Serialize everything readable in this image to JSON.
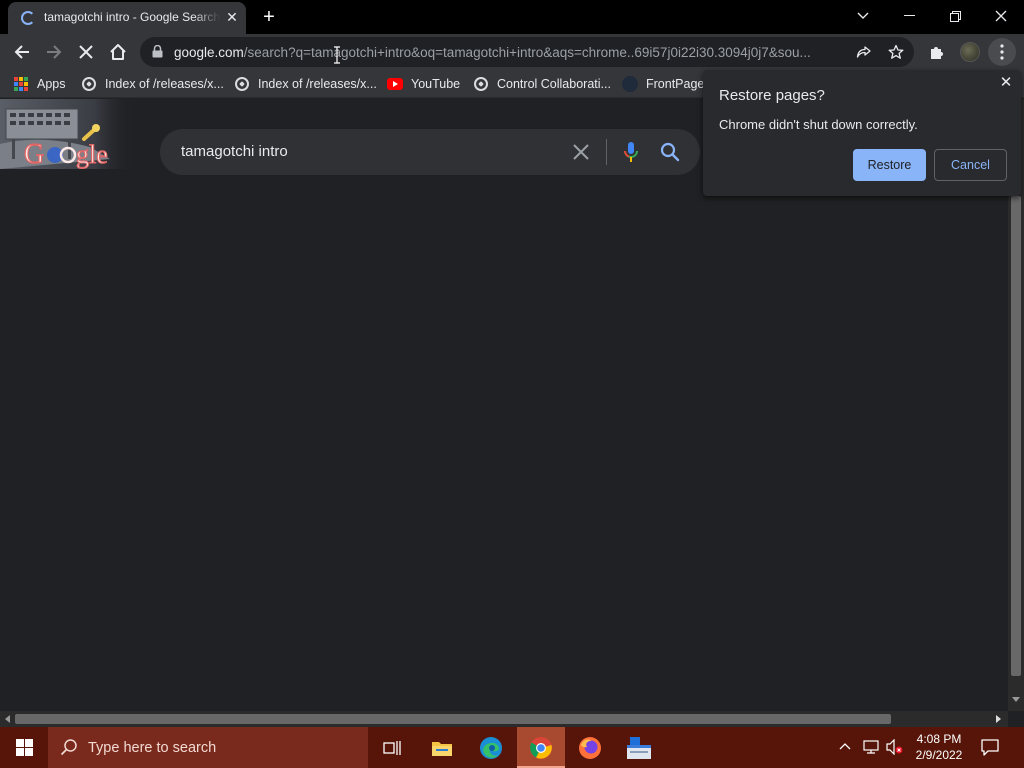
{
  "tab": {
    "title": "tamagotchi intro - Google Search",
    "close_glyph": "✕",
    "new_tab_glyph": "+"
  },
  "window_controls": [
    "chevron-down-icon",
    "minimize-icon",
    "restore-icon",
    "close-icon"
  ],
  "toolbar": {
    "url_host": "google.com",
    "url_path": "/search?q=tamagotchi+intro&oq=tamagotchi+intro&aqs=chrome..69i57j0i22i30.3094j0j7&sou..."
  },
  "bookmarks": [
    {
      "label": "Apps",
      "icon": "apps-grid-icon"
    },
    {
      "label": "Index of /releases/x...",
      "icon": "globe-icon"
    },
    {
      "label": "Index of /releases/x...",
      "icon": "globe-icon"
    },
    {
      "label": "YouTube",
      "icon": "youtube-icon"
    },
    {
      "label": "Control Collaborati...",
      "icon": "globe-icon"
    },
    {
      "label": "FrontPage",
      "icon": "frontpage-icon"
    }
  ],
  "search": {
    "query": "tamagotchi intro"
  },
  "restore_popup": {
    "title": "Restore pages?",
    "message": "Chrome didn't shut down correctly.",
    "restore_label": "Restore",
    "cancel_label": "Cancel",
    "close_glyph": "✕"
  },
  "taskbar": {
    "search_placeholder": "Type here to search",
    "time": "4:08 PM",
    "date": "2/9/2022"
  },
  "colors": {
    "accent": "#8ab4f8",
    "taskbar": "#561508",
    "page_bg": "#202124"
  }
}
